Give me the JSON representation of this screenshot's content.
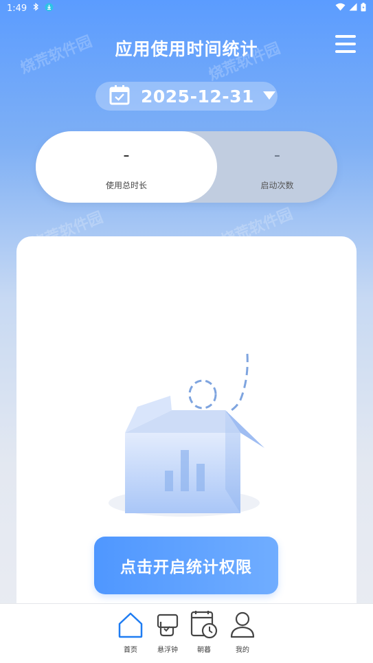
{
  "status_bar": {
    "time": "1:49"
  },
  "header": {
    "title": "应用使用时间统计"
  },
  "date_selector": {
    "date": "2025-12-31"
  },
  "stats": {
    "total_duration": {
      "value": "-",
      "label": "使用总时长"
    },
    "launch_count": {
      "value": "-",
      "label": "启动次数"
    }
  },
  "main": {
    "permission_button": "点击开启统计权限"
  },
  "watermark": "烧荒软件园",
  "bottom_nav": {
    "items": [
      {
        "label": "首页",
        "icon": "home-icon",
        "active": true
      },
      {
        "label": "悬浮钟",
        "icon": "floating-clock-icon",
        "active": false
      },
      {
        "label": "朝暮",
        "icon": "calendar-clock-icon",
        "active": false
      },
      {
        "label": "我的",
        "icon": "person-icon",
        "active": false
      }
    ]
  },
  "colors": {
    "accent": "#4f97ff",
    "nav_active": "#1e7cf2"
  }
}
